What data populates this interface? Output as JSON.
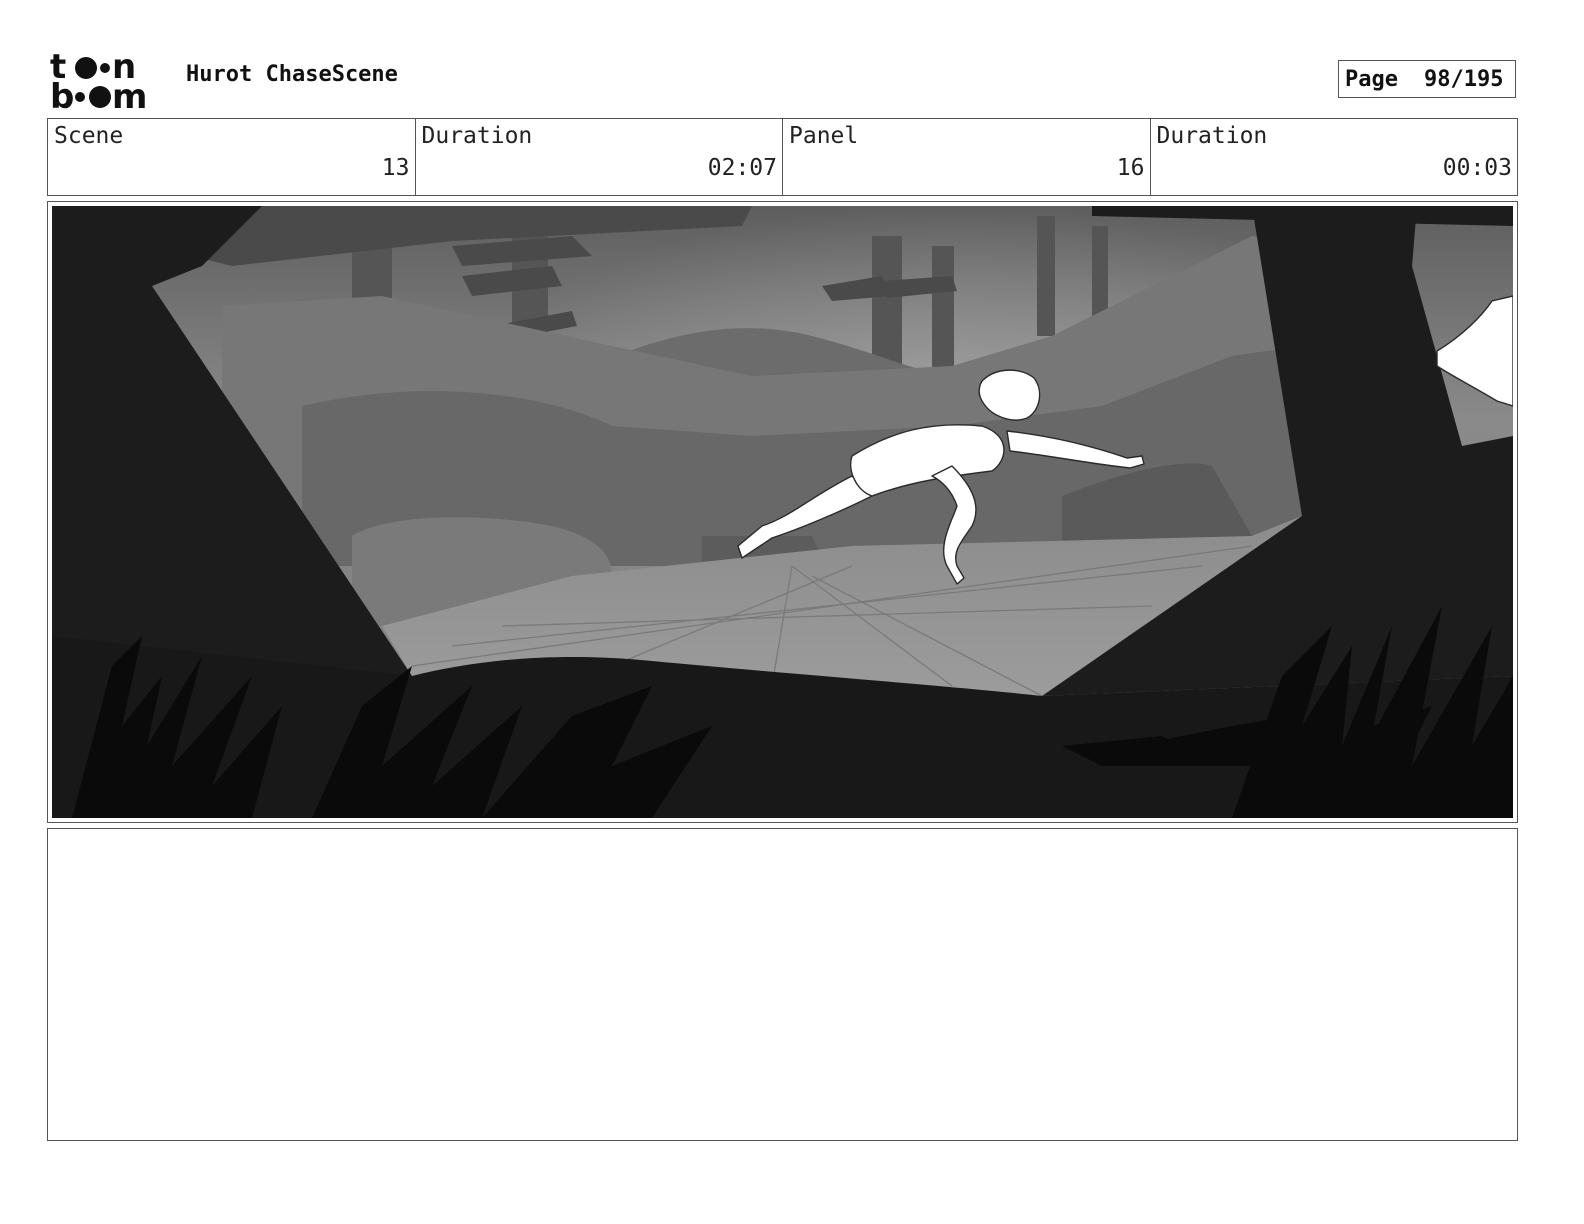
{
  "header": {
    "logo": {
      "icon": "toon-boom-logo",
      "text_top": "toon",
      "text_bottom": "boom"
    },
    "project_title": "Hurot ChaseScene",
    "page": {
      "label": "Page",
      "value": "98/195"
    }
  },
  "info": {
    "scene_label": "Scene",
    "scene_value": "13",
    "scene_duration_label": "Duration",
    "scene_duration_value": "02:07",
    "panel_label": "Panel",
    "panel_value": "16",
    "panel_duration_label": "Duration",
    "panel_duration_value": "00:03"
  },
  "panel": {
    "art": "storyboard-panel-forest-chase",
    "colors": {
      "silhouette": "#181818",
      "sky": "#9a9a9a",
      "midground": "#707070",
      "ground": "#8e8e8e",
      "character": "#ffffff"
    }
  },
  "notes": {
    "text": ""
  }
}
